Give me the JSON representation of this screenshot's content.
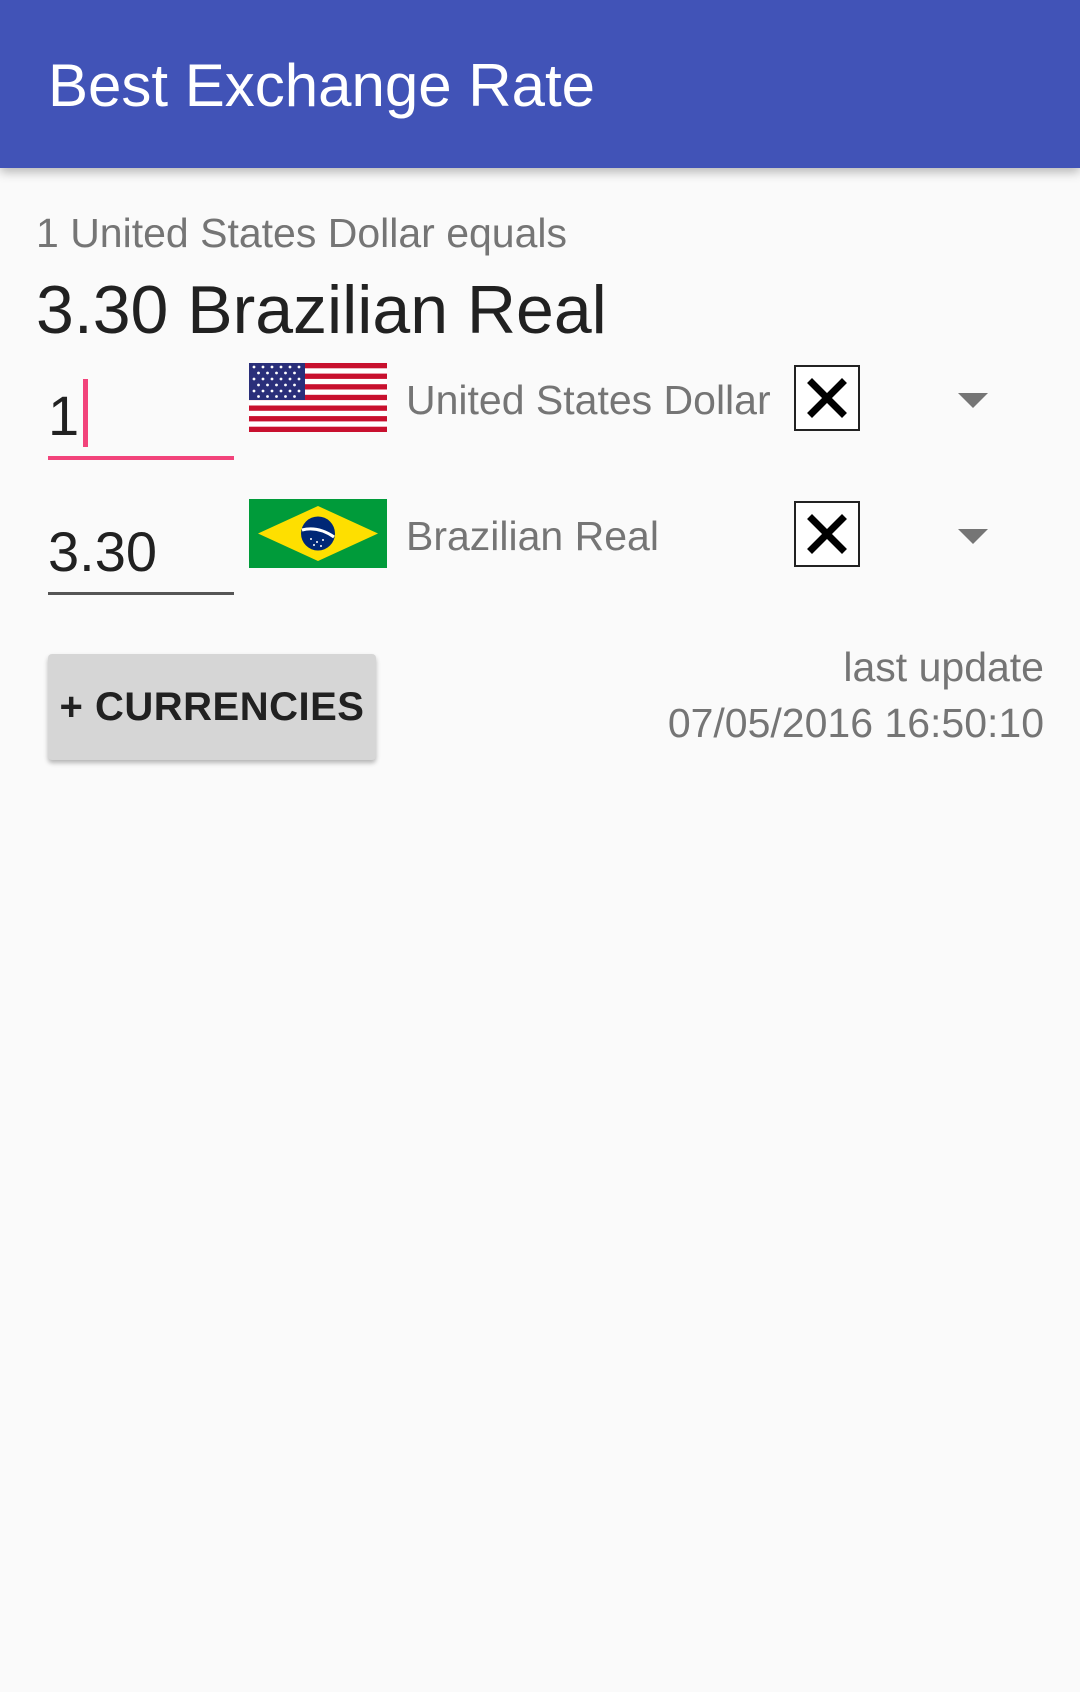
{
  "app_bar": {
    "title": "Best Exchange Rate"
  },
  "summary": {
    "caption": "1 United States Dollar equals",
    "result": "3.30 Brazilian Real"
  },
  "currencies": [
    {
      "amount": "1",
      "name": "United States Dollar",
      "flag_icon": "us-flag-icon",
      "focused": true
    },
    {
      "amount": "3.30",
      "name": "Brazilian Real",
      "flag_icon": "brazil-flag-icon",
      "focused": false
    }
  ],
  "actions": {
    "add_currencies_label": "+ CURRENCIES"
  },
  "update": {
    "label": "last update",
    "timestamp": "07/05/2016 16:50:10"
  },
  "colors": {
    "app_bar": "#4153b7",
    "accent": "#f2437b",
    "background": "#fafafa",
    "secondary_text": "#757575",
    "button": "#d6d6d6"
  }
}
